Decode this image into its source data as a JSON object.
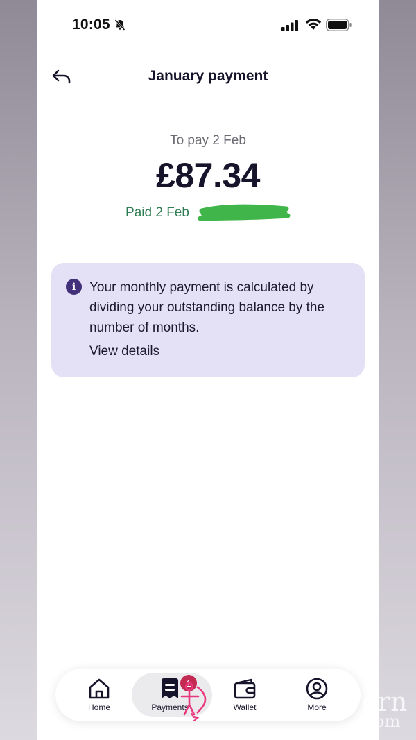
{
  "status_bar": {
    "time": "10:05",
    "icons": [
      "bell-slash-icon",
      "cellular-signal-icon",
      "wifi-icon",
      "battery-icon"
    ]
  },
  "header": {
    "title": "January payment",
    "back_icon": "back-arrow-icon"
  },
  "payment": {
    "due_label": "To pay 2 Feb",
    "amount": "£87.34",
    "paid_label": "Paid 2 Feb",
    "paid_color": "#2f7d52",
    "redaction_color": "#3fb54a"
  },
  "info_card": {
    "icon": "info-icon",
    "text": "Your monthly payment is calculated by dividing your outstanding balance by the number of months.",
    "link": "View details",
    "background": "#e4e0f6"
  },
  "bottom_nav": {
    "items": [
      {
        "label": "Home",
        "icon": "home-icon"
      },
      {
        "label": "Payments",
        "icon": "receipt-icon",
        "active": true,
        "badge": "1"
      },
      {
        "label": "Wallet",
        "icon": "wallet-icon"
      },
      {
        "label": "More",
        "icon": "profile-icon"
      }
    ],
    "badge_color": "#c22a52"
  },
  "watermark": {
    "icon": "cupid-watermark-icon",
    "text_line1": "orn",
    "text_line2": "om"
  }
}
